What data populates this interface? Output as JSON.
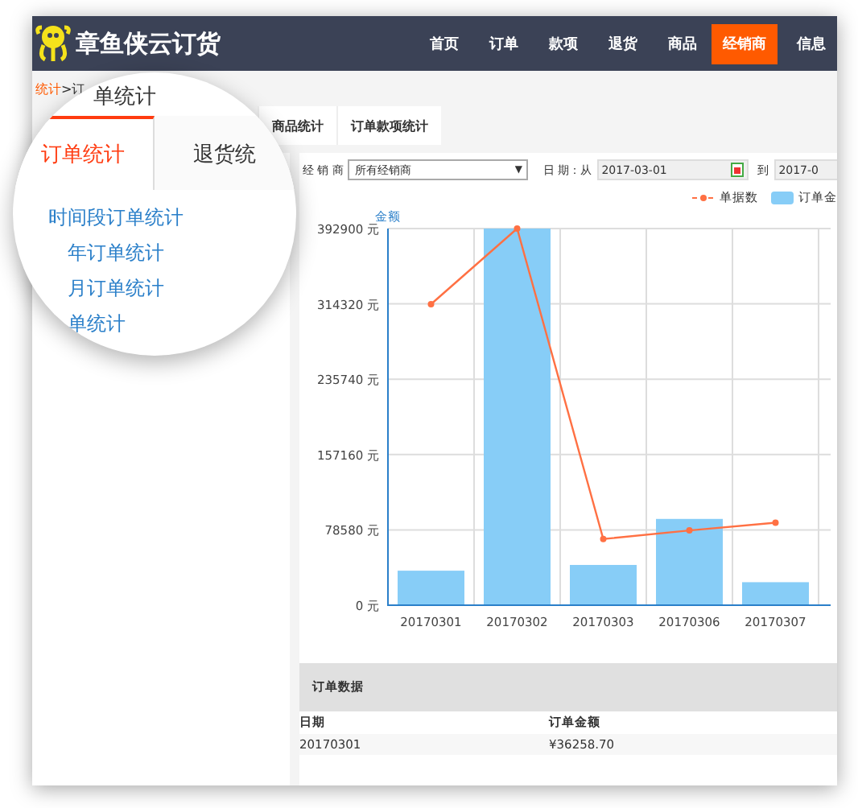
{
  "header": {
    "brand": "章鱼侠云订货",
    "nav": [
      {
        "label": "首页",
        "selected": false
      },
      {
        "label": "订单",
        "selected": false
      },
      {
        "label": "款项",
        "selected": false
      },
      {
        "label": "退货",
        "selected": false
      },
      {
        "label": "商品",
        "selected": false
      },
      {
        "label": "经销商",
        "selected": true
      },
      {
        "label": "信息",
        "selected": false
      }
    ]
  },
  "breadcrumb": {
    "root": "统计",
    "separator": ">",
    "current": "订"
  },
  "tabs": [
    {
      "label": "商品统计",
      "selected": false
    },
    {
      "label": "订单款项统计",
      "selected": false
    }
  ],
  "magnifier": {
    "breadcrumb_tail": "单统计",
    "tabs": [
      {
        "label": "订单统计",
        "selected": true
      },
      {
        "label": "退货统",
        "selected": false
      }
    ],
    "menu": [
      {
        "label": "时间段订单统计",
        "children": [
          {
            "label": "年订单统计"
          },
          {
            "label": "月订单统计"
          },
          {
            "label": "单统计"
          }
        ]
      }
    ]
  },
  "filters": {
    "dealer_label": "经 销 商",
    "dealer_value": "所有经销商",
    "dealer_caret": "▼",
    "date_label": "日 期：从",
    "date_from": "2017-03-01",
    "to_label": "到",
    "date_to": "2017-0"
  },
  "chart": {
    "chart_data": {
      "type": "bar",
      "ylabel": "金额",
      "categories": [
        "20170301",
        "20170302",
        "20170303",
        "20170306",
        "20170307"
      ],
      "series": [
        {
          "name": "单据数",
          "type": "line",
          "marker": true,
          "color": "#ff7043",
          "values": [
            314000,
            392900,
            69000,
            78000,
            86000
          ]
        },
        {
          "name": "订单金",
          "color": "#87cdf7",
          "values": [
            36000,
            392900,
            42000,
            90000,
            24000
          ]
        }
      ],
      "grid": true,
      "ylim": [
        0,
        392900
      ],
      "yticks": [
        {
          "value": 0,
          "label": "0 元"
        },
        {
          "value": 78580,
          "label": "78580 元"
        },
        {
          "value": 157160,
          "label": "157160 元"
        },
        {
          "value": 235740,
          "label": "235740 元"
        },
        {
          "value": 314320,
          "label": "314320 元"
        },
        {
          "value": 392900,
          "label": "392900 元"
        }
      ]
    }
  },
  "table": {
    "title": "订单数据",
    "columns": [
      "日期",
      "订单金额"
    ],
    "rows": [
      [
        "20170301",
        "¥36258.70"
      ]
    ]
  }
}
